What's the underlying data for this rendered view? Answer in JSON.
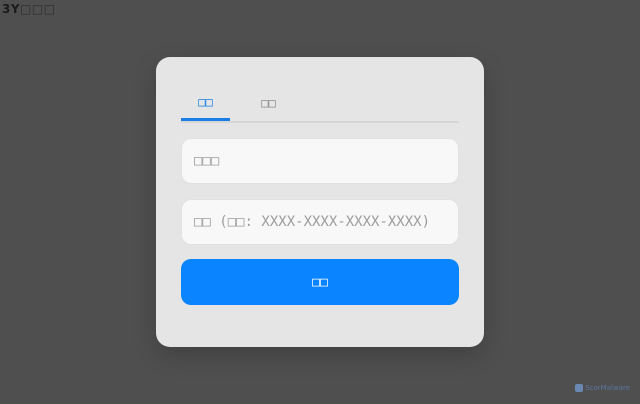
{
  "corner_label": {
    "prefix": "3Y",
    "suffix": "□□□"
  },
  "tabs": [
    {
      "label": "□□",
      "active": true
    },
    {
      "label": "□□",
      "active": false
    }
  ],
  "form": {
    "username_placeholder": "□□□",
    "key_placeholder": "□□ (□□: XXXX-XXXX-XXXX-XXXX)",
    "submit_label": "□□"
  },
  "watermark": {
    "text": "ScorMalware"
  },
  "colors": {
    "accent": "#0a84ff",
    "tab_active": "#1a7ee6",
    "background": "#4f4f4f",
    "card": "#e5e5e5"
  },
  "icons": {
    "watermark_logo": "logo-icon"
  }
}
